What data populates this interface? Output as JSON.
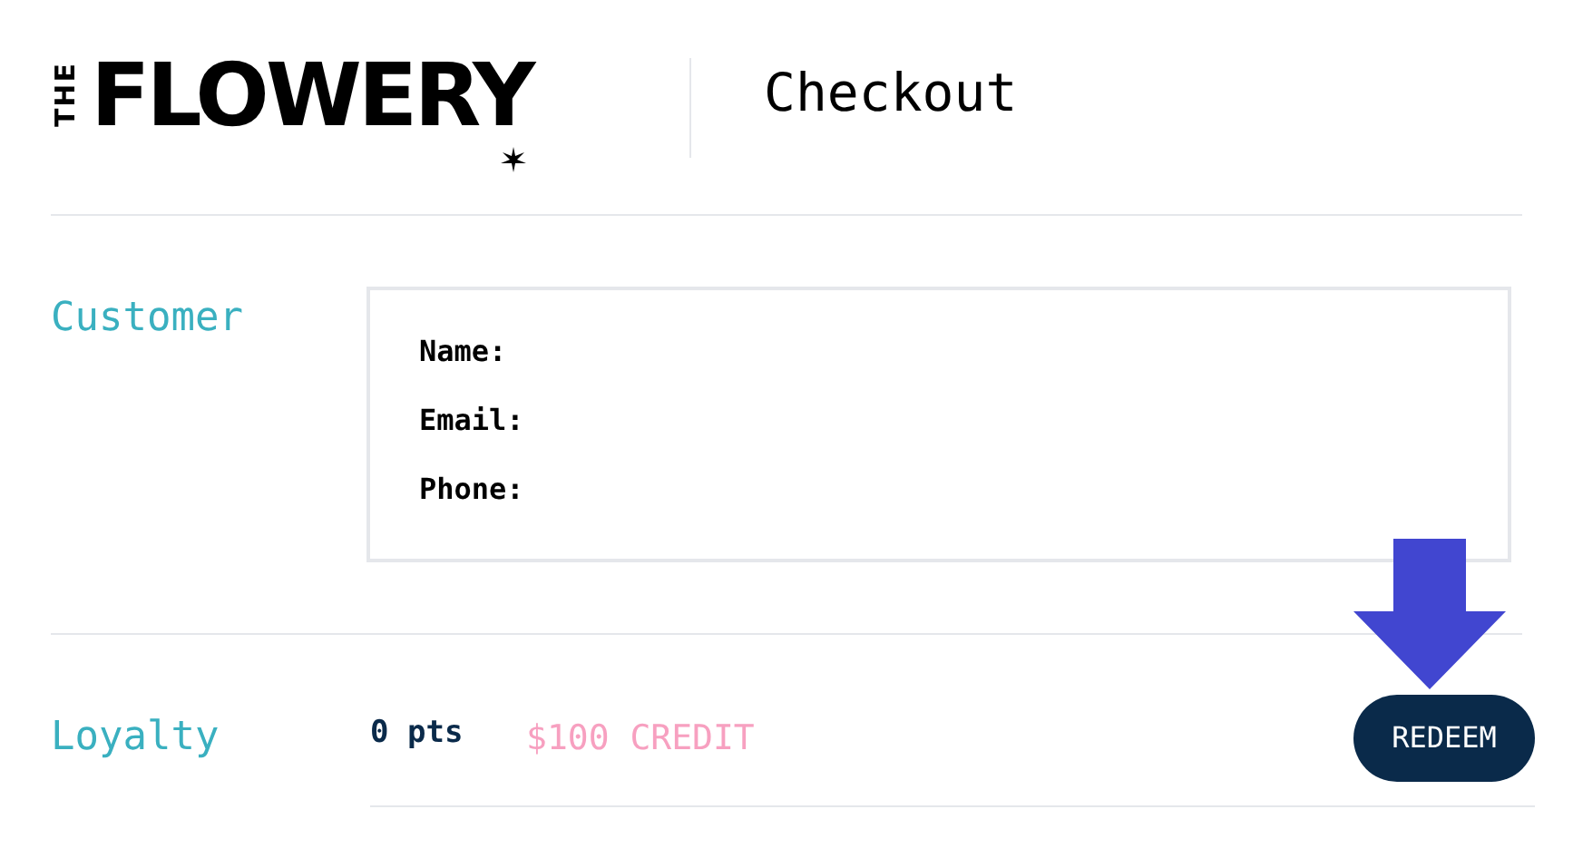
{
  "logo": {
    "prefix": "THE",
    "name": "FLOWERY"
  },
  "header": {
    "title": "Checkout"
  },
  "customer": {
    "label": "Customer",
    "fields": [
      "Name:",
      "Email:",
      "Phone:"
    ]
  },
  "loyalty": {
    "label": "Loyalty",
    "points": "0 pts",
    "credit": "$100 CREDIT",
    "button": "REDEEM"
  }
}
